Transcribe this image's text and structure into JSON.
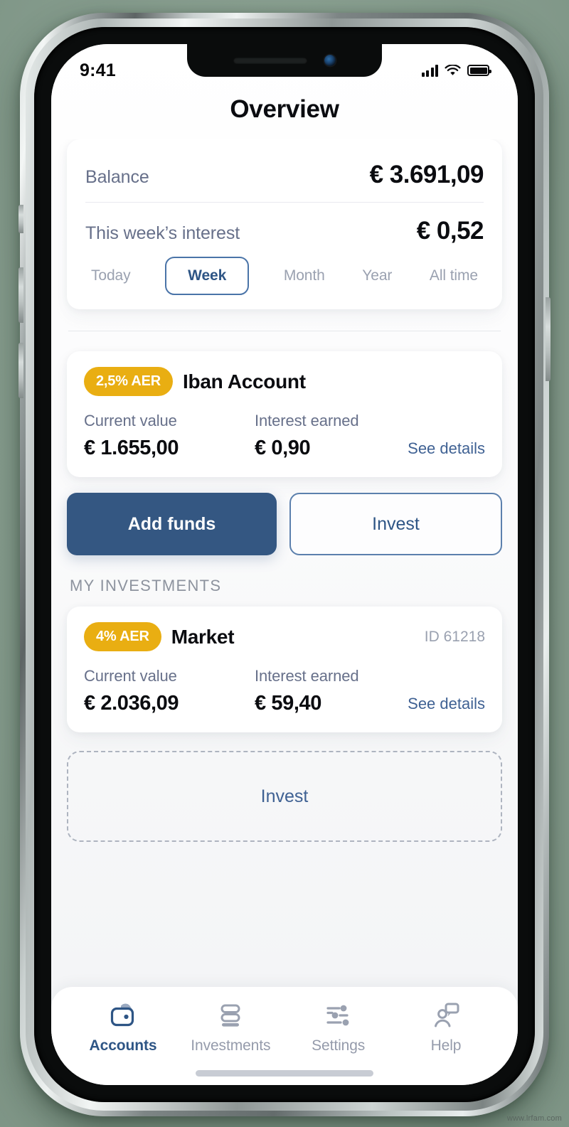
{
  "status_bar": {
    "time": "9:41",
    "signal_icon": "cellular-signal-icon",
    "wifi_icon": "wifi-icon",
    "battery_icon": "battery-full-icon"
  },
  "header": {
    "title": "Overview"
  },
  "balance_card": {
    "balance_label": "Balance",
    "balance_value": "€ 3.691,09",
    "interest_label": "This week’s interest",
    "interest_value": "€ 0,52",
    "period_tabs": [
      {
        "label": "Today",
        "selected": false
      },
      {
        "label": "Week",
        "selected": true
      },
      {
        "label": "Month",
        "selected": false
      },
      {
        "label": "Year",
        "selected": false
      },
      {
        "label": "All time",
        "selected": false
      }
    ]
  },
  "iban_account": {
    "badge": "2,5% AER",
    "name": "Iban Account",
    "current_value_label": "Current value",
    "current_value": "€ 1.655,00",
    "interest_label": "Interest earned",
    "interest_value": "€ 0,90",
    "details_link": "See details"
  },
  "actions": {
    "add_funds_label": "Add funds",
    "invest_label": "Invest"
  },
  "investments_section": {
    "heading": "MY INVESTMENTS",
    "market": {
      "badge": "4% AER",
      "name": "Market",
      "id": "ID 61218",
      "current_value_label": "Current value",
      "current_value": "€ 2.036,09",
      "interest_label": "Interest earned",
      "interest_value": "€ 59,40",
      "details_link": "See details"
    },
    "invest_placeholder_label": "Invest"
  },
  "tabbar": {
    "items": [
      {
        "label": "Accounts",
        "icon": "wallet-icon",
        "active": true
      },
      {
        "label": "Investments",
        "icon": "layers-icon",
        "active": false
      },
      {
        "label": "Settings",
        "icon": "sliders-icon",
        "active": false
      },
      {
        "label": "Help",
        "icon": "person-chat-icon",
        "active": false
      }
    ]
  },
  "watermark": {
    "text": "www.lrfam.com"
  },
  "colors": {
    "accent_blue": "#345782",
    "link_blue": "#3f6193",
    "badge_amber": "#e9ae12",
    "muted_text": "#67708a",
    "inactive_text": "#959bab"
  }
}
